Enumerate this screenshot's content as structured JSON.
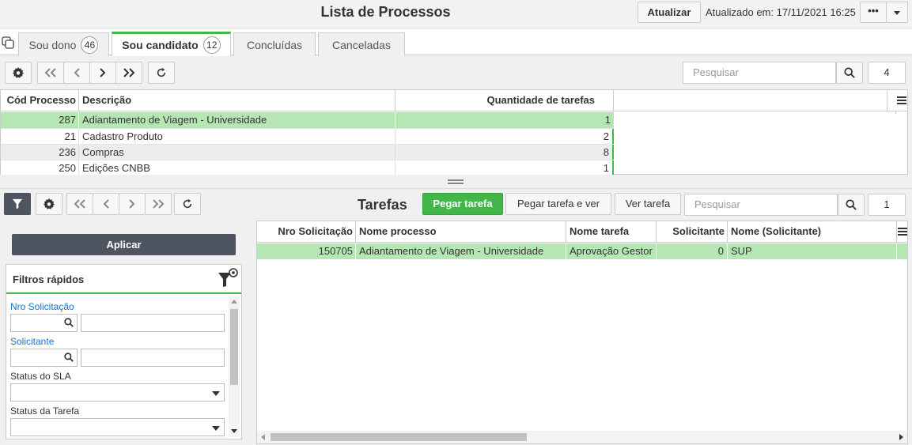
{
  "header": {
    "title": "Lista de Processos",
    "refresh_label": "Atualizar",
    "updated_at": "Atualizado em: 17/11/2021 16:25",
    "more_label": "•••"
  },
  "tabs": [
    {
      "label": "Sou dono",
      "count": "46"
    },
    {
      "label": "Sou candidato",
      "count": "12"
    },
    {
      "label": "Concluídas",
      "count": ""
    },
    {
      "label": "Canceladas",
      "count": ""
    }
  ],
  "process_toolbar": {
    "search_placeholder": "Pesquisar",
    "count": "4"
  },
  "process_table": {
    "columns": [
      "Cód Processo",
      "Descrição",
      "Quantidade de tarefas"
    ],
    "rows": [
      {
        "code": "287",
        "description": "Adiantamento de Viagem - Universidade",
        "tasks": "1",
        "selected": true
      },
      {
        "code": "21",
        "description": "Cadastro Produto",
        "tasks": "2",
        "selected": false
      },
      {
        "code": "236",
        "description": "Compras",
        "tasks": "8",
        "selected": false
      },
      {
        "code": "250",
        "description": "Edições CNBB",
        "tasks": "1",
        "selected": false
      }
    ]
  },
  "tasks_section": {
    "title": "Tarefas",
    "take_task_label": "Pegar tarefa",
    "take_and_view_label": "Pegar tarefa e ver",
    "view_task_label": "Ver tarefa",
    "search_placeholder": "Pesquisar",
    "count": "1"
  },
  "filters": {
    "apply_label": "Aplicar",
    "title": "Filtros rápidos",
    "fields": [
      {
        "label": "Nro Solicitação"
      },
      {
        "label": "Solicitante"
      },
      {
        "label": "Status do SLA"
      },
      {
        "label": "Status da Tarefa"
      }
    ]
  },
  "tasks_table": {
    "columns": [
      "Nro Solicitação",
      "Nome processo",
      "Nome tarefa",
      "Solicitante",
      "Nome (Solicitante)"
    ],
    "rows": [
      {
        "request": "150705",
        "process": "Adiantamento de Viagem - Universidade",
        "task": "Aprovação Gestor",
        "requester": "0",
        "requester_name": "SUP"
      }
    ]
  },
  "colors": {
    "accent_green": "#43b649",
    "selected_row": "#b6e6b4",
    "link_blue": "#1a73c9",
    "dark_button": "#4e5460"
  }
}
